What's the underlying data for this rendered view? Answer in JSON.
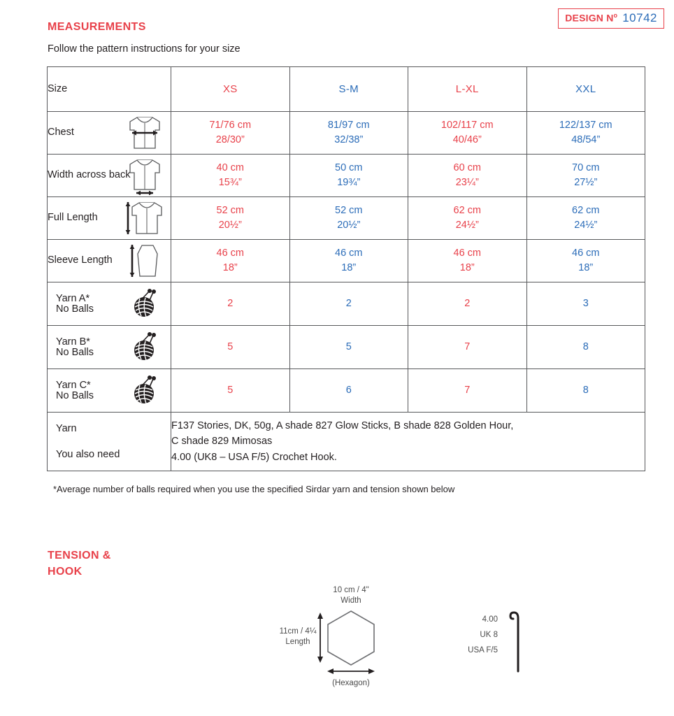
{
  "design_badge": {
    "label": "DESIGN N",
    "superscript": "o",
    "number": "10742"
  },
  "measurements": {
    "heading": "MEASUREMENTS",
    "subtitle": "Follow the pattern instructions for your size",
    "footnote": "*Average number of balls required when you use the specified Sirdar yarn and tension shown below",
    "columns": [
      {
        "label": "Size",
        "color": "#231f20"
      },
      {
        "label": "XS",
        "color": "#e8414a"
      },
      {
        "label": "S-M",
        "color": "#2b6cb8"
      },
      {
        "label": "L-XL",
        "color": "#e8414a"
      },
      {
        "label": "XXL",
        "color": "#2b6cb8"
      }
    ],
    "rows": [
      {
        "label": "Chest",
        "icon": "garment-chest-icon",
        "values": [
          {
            "cm": "71/76 cm",
            "inch": "28/30”"
          },
          {
            "cm": "81/97 cm",
            "inch": "32/38”"
          },
          {
            "cm": "102/117 cm",
            "inch": "40/46”"
          },
          {
            "cm": "122/137 cm",
            "inch": "48/54”"
          }
        ]
      },
      {
        "label": "Width across back",
        "icon": "garment-width-back-icon",
        "values": [
          {
            "cm": "40 cm",
            "inch": "15¾”"
          },
          {
            "cm": "50 cm",
            "inch": "19¾”"
          },
          {
            "cm": "60 cm",
            "inch": "23¼”"
          },
          {
            "cm": "70 cm",
            "inch": "27½”"
          }
        ]
      },
      {
        "label": "Full Length",
        "icon": "garment-full-length-icon",
        "values": [
          {
            "cm": "52 cm",
            "inch": "20½”"
          },
          {
            "cm": "52 cm",
            "inch": "20½”"
          },
          {
            "cm": "62 cm",
            "inch": "24½”"
          },
          {
            "cm": "62 cm",
            "inch": "24½”"
          }
        ]
      },
      {
        "label": "Sleeve Length",
        "icon": "sleeve-icon",
        "values": [
          {
            "cm": "46 cm",
            "inch": "18”"
          },
          {
            "cm": "46 cm",
            "inch": "18”"
          },
          {
            "cm": "46 cm",
            "inch": "18”"
          },
          {
            "cm": "46 cm",
            "inch": "18”"
          }
        ]
      }
    ],
    "ball_rows": [
      {
        "label_top": "Yarn A*",
        "label_bottom": "No Balls",
        "icon": "yarn-ball-icon",
        "values": [
          "2",
          "2",
          "2",
          "3"
        ]
      },
      {
        "label_top": "Yarn B*",
        "label_bottom": "No Balls",
        "icon": "yarn-ball-icon",
        "values": [
          "5",
          "5",
          "7",
          "8"
        ]
      },
      {
        "label_top": "Yarn C*",
        "label_bottom": "No Balls",
        "icon": "yarn-ball-icon",
        "values": [
          "5",
          "6",
          "7",
          "8"
        ]
      }
    ],
    "yarn_row": {
      "label_top": "Yarn",
      "label_bottom": "You also need",
      "detail_line1": "F137 Stories, DK, 50g,  A shade 827 Glow Sticks, B shade 828 Golden Hour,",
      "detail_line2": "C shade 829 Mimosas",
      "detail_line3": "4.00 (UK8 – USA F/5) Crochet Hook."
    }
  },
  "tension": {
    "heading": "TENSION &\nHOOK",
    "width_label_line1": "10 cm / 4\"",
    "width_label_line2": "Width",
    "length_label_line1": "11cm / 4¼",
    "length_label_line2": "Length",
    "shape_label": "(Hexagon)",
    "hook": {
      "size_metric": "4.00",
      "size_uk": "UK 8",
      "size_usa": "USA F/5"
    }
  },
  "colors": {
    "accent_red": "#e8414a",
    "accent_blue": "#2b6cb8",
    "text": "#231f20",
    "border": "#58595b"
  }
}
